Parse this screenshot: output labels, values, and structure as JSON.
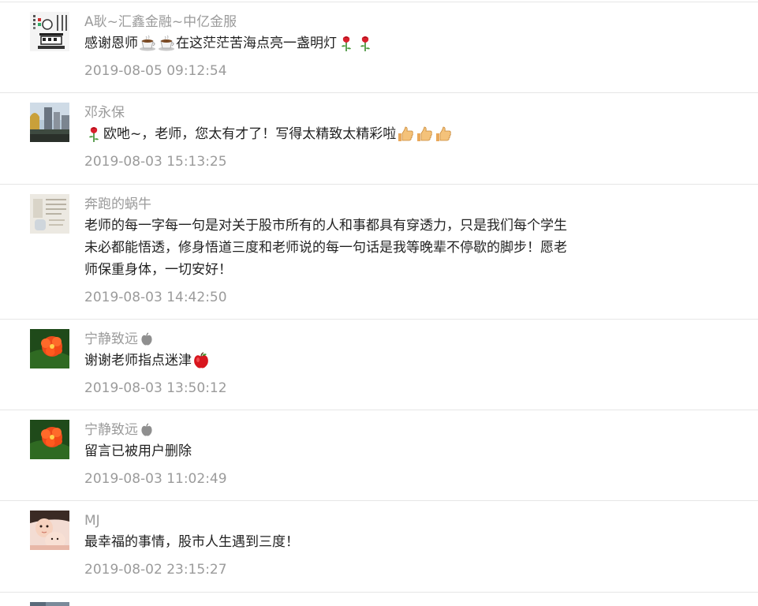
{
  "comments": [
    {
      "nick": "A耿~汇鑫金融~中亿金服",
      "text": "感谢恩师 在这茫茫苦海点亮一盏明灯",
      "text_parts": [
        "感谢恩师",
        "在这茫茫苦海点亮一盏明灯"
      ],
      "emojis": [
        "coffee-icon",
        "coffee-icon",
        "rose-icon",
        "rose-icon"
      ],
      "time": "2019-08-05 09:12:54",
      "avatar": "building-avatar"
    },
    {
      "nick": "邓永保",
      "text": "欧吔~，老师，您太有才了！写得太精致太精彩啦",
      "text_parts": [
        "欧吔~，老师，您太有才了！写得太精致太精彩啦"
      ],
      "emojis": [
        "rose-icon",
        "thumbs-up-icon",
        "thumbs-up-icon",
        "thumbs-up-icon"
      ],
      "time": "2019-08-03 15:13:25",
      "avatar": "city-avatar"
    },
    {
      "nick": "奔跑的蜗牛",
      "text_lines": [
        "老师的每一字每一句是对关于股市所有的人和事都具有穿透力，只是我们每个学生",
        "未必都能悟透，修身悟道三度和老师说的每一句话是我等晚辈不停歇的脚步！愿老",
        "师保重身体，一切安好！"
      ],
      "time": "2019-08-03 14:42:50",
      "avatar": "paper-avatar"
    },
    {
      "nick": "宁静致远",
      "text": "谢谢老师指点迷津",
      "emojis": [
        "apple-icon",
        "red-apple-icon"
      ],
      "time": "2019-08-03 13:50:12",
      "avatar": "flower-avatar"
    },
    {
      "nick": "宁静致远",
      "text": "留言已被用户删除",
      "emojis": [
        "apple-icon"
      ],
      "time": "2019-08-03 11:02:49",
      "avatar": "flower-avatar"
    },
    {
      "nick": "MJ",
      "text": "最幸福的事情，股市人生遇到三度！",
      "time": "2019-08-02 23:15:27",
      "avatar": "baby-avatar"
    }
  ],
  "colors": {
    "nick": "#9b9b9b",
    "text": "#222222",
    "time": "#9b9b9b",
    "divider": "#e6e6e6"
  }
}
